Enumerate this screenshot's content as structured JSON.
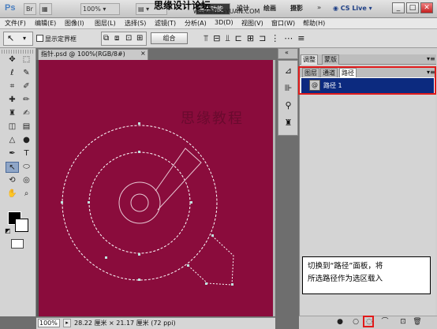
{
  "app": {
    "logo": "Ps",
    "zoom": "100%",
    "workspace": "基本功能",
    "design_tab": "设计",
    "paint_tab": "绘画",
    "photo_tab": "摄影",
    "cs_live": "CS Live",
    "window_buttons": [
      "_",
      "□",
      "✕"
    ]
  },
  "watermark": {
    "top": "思缘设计论坛",
    "site": "www.MISSYUAN.COM",
    "canvas": "思缘教程"
  },
  "menu": [
    "文件(F)",
    "编辑(E)",
    "图像(I)",
    "图层(L)",
    "选择(S)",
    "滤镜(T)",
    "分析(A)",
    "3D(D)",
    "视图(V)",
    "窗口(W)",
    "帮助(H)"
  ],
  "options": {
    "auto_select": "显示定界框",
    "combine": "组合"
  },
  "document": {
    "tab": "指针.psd @ 100%(RGB/8#)",
    "close": "×",
    "zoom": "100%",
    "size": "28.22 厘米 × 21.17 厘米 (72 ppi)",
    "canvas_color": "#8a0c3c"
  },
  "panels": {
    "top_tabs": [
      "调整",
      "蒙版"
    ],
    "mid_tabs": [
      "图层",
      "通道",
      "路径"
    ],
    "active_tab": "路径",
    "path_name": "路径 1"
  },
  "note": {
    "line1": "切换到“路径”面板，将",
    "line2": "所选路径作为选区载入"
  }
}
